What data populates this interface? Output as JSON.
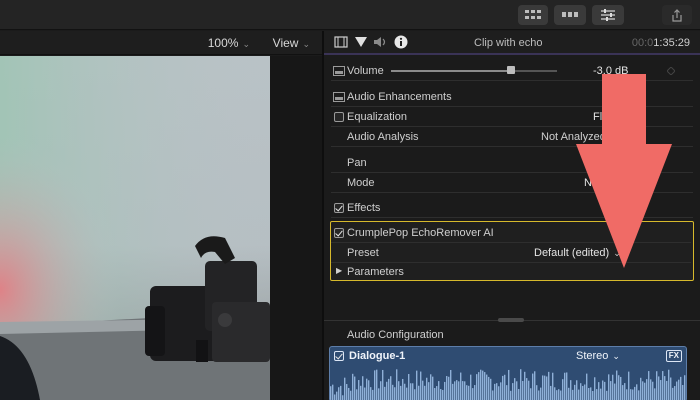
{
  "viewer": {
    "zoom": "100%",
    "view_label": "View"
  },
  "inspector": {
    "clip_title": "Clip with echo",
    "timecode_dim": "00:0",
    "timecode": "1:35:29",
    "volume": {
      "label": "Volume",
      "value": "-3.0 dB",
      "level": 0.72
    },
    "audio_enhancements": {
      "header": "Audio Enhancements",
      "equalization_label": "Equalization",
      "equalization_value": "Fl",
      "audio_analysis_label": "Audio Analysis",
      "audio_analysis_value": "Not Analyzed"
    },
    "pan": {
      "header": "Pan",
      "mode_label": "Mode",
      "mode_value": "Non"
    },
    "effects": {
      "header": "Effects",
      "effect_name": "CrumplePop EchoRemover AI",
      "preset_label": "Preset",
      "preset_value": "Default (edited)",
      "parameters_label": "Parameters"
    },
    "audio_configuration": {
      "title": "Audio Configuration",
      "lane_name": "Dialogue-1",
      "channel_value": "Stereo",
      "fx_badge": "FX"
    }
  },
  "colors": {
    "effect_highlight": "#d6b92c",
    "arrow": "#f06b66",
    "lane": "#2f4c72"
  }
}
